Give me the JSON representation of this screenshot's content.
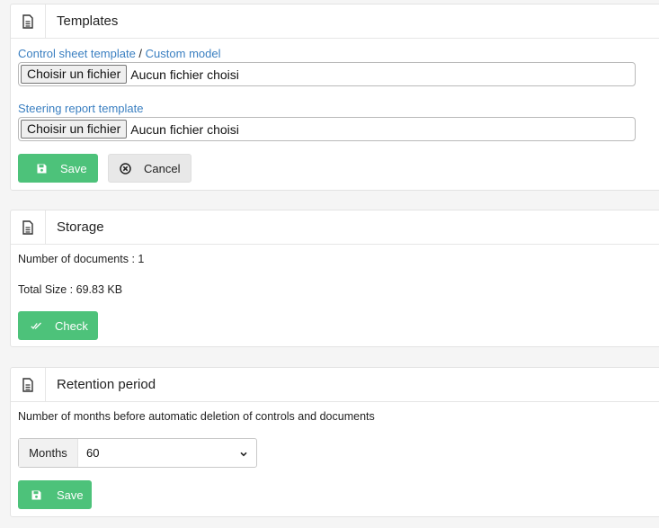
{
  "templates": {
    "title": "Templates",
    "control_sheet_link": "Control sheet template",
    "separator": "/",
    "custom_model_link": "Custom model",
    "file_button_label": "Choisir un fichier",
    "file_status": "Aucun fichier choisi",
    "steering_report_link": "Steering report template",
    "save_label": "Save",
    "cancel_label": "Cancel"
  },
  "storage": {
    "title": "Storage",
    "documents_count": "Number of documents : 1",
    "total_size": "Total Size : 69.83 KB",
    "check_label": "Check"
  },
  "retention": {
    "title": "Retention period",
    "description": "Number of months before automatic deletion of controls and documents",
    "unit_label": "Months",
    "selected_value": "60",
    "save_label": "Save"
  },
  "colors": {
    "success": "#4dc27a",
    "link": "#3a7fc1",
    "neutral_button": "#e8e8e8"
  },
  "icons": {
    "panel": "document-icon",
    "save": "floppy-disk-icon",
    "cancel": "circle-x-icon",
    "check": "double-check-icon",
    "select": "chevron-down-icon"
  }
}
